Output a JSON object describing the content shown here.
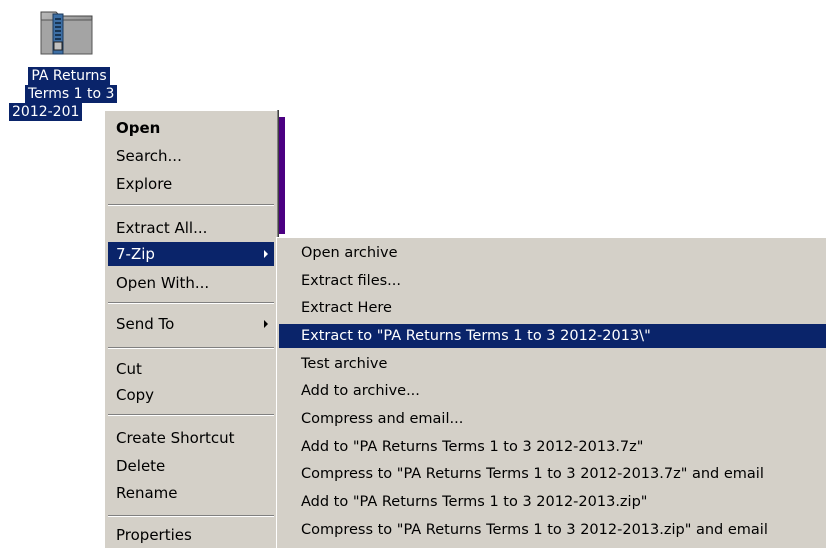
{
  "desktop_icon": {
    "icon": "zip-folder-icon",
    "label_lines": [
      "PA Returns",
      "Terms 1 to 3",
      "2012-201"
    ]
  },
  "context_menu": {
    "items": [
      {
        "label": "Open",
        "bold": true
      },
      {
        "label": "Search..."
      },
      {
        "label": "Explore"
      },
      {
        "label": "Extract All..."
      },
      {
        "label": "7-Zip",
        "submenu": true,
        "active": true
      },
      {
        "label": "Open With..."
      },
      {
        "label": "Send To",
        "submenu": true
      },
      {
        "label": "Cut"
      },
      {
        "label": "Copy"
      },
      {
        "label": "Create Shortcut"
      },
      {
        "label": "Delete"
      },
      {
        "label": "Rename"
      },
      {
        "label": "Properties"
      }
    ]
  },
  "submenu_7zip": {
    "items": [
      {
        "label": "Open archive"
      },
      {
        "label": "Extract files..."
      },
      {
        "label": "Extract Here"
      },
      {
        "label": "Extract to \"PA Returns Terms 1 to 3 2012-2013\\\"",
        "active": true
      },
      {
        "label": "Test archive"
      },
      {
        "label": "Add to archive..."
      },
      {
        "label": "Compress and email..."
      },
      {
        "label": "Add to \"PA Returns Terms 1 to 3 2012-2013.7z\""
      },
      {
        "label": "Compress to \"PA Returns Terms 1 to 3 2012-2013.7z\" and email"
      },
      {
        "label": "Add to \"PA Returns Terms 1 to 3 2012-2013.zip\""
      },
      {
        "label": "Compress to \"PA Returns Terms 1 to 3 2012-2013.zip\" and email"
      }
    ]
  },
  "colors": {
    "highlight": "#0a246a",
    "menu_bg": "#d4d0c8"
  }
}
